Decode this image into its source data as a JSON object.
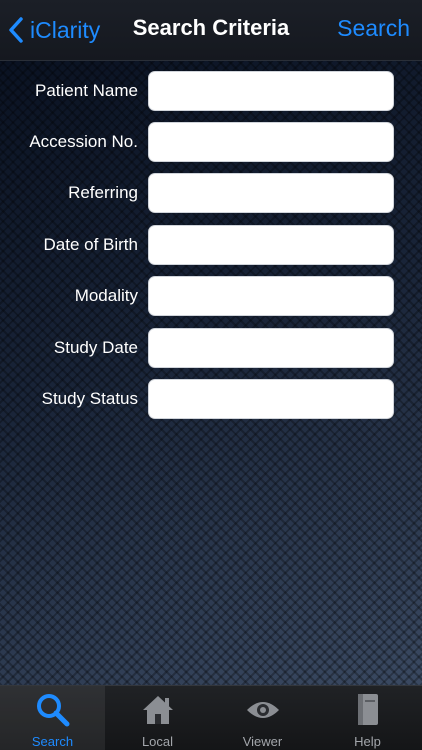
{
  "navbar": {
    "back_label": "iClarity",
    "title": "Search Criteria",
    "action_label": "Search"
  },
  "form": {
    "fields": [
      {
        "label": "Patient Name",
        "value": "",
        "placeholder": ""
      },
      {
        "label": "Accession No.",
        "value": "",
        "placeholder": ""
      },
      {
        "label": "Referring",
        "value": "",
        "placeholder": ""
      },
      {
        "label": "Date of Birth",
        "value": "",
        "placeholder": ""
      },
      {
        "label": "Modality",
        "value": "",
        "placeholder": ""
      },
      {
        "label": "Study Date",
        "value": "",
        "placeholder": ""
      },
      {
        "label": "Study Status",
        "value": "",
        "placeholder": ""
      }
    ]
  },
  "tabbar": {
    "tabs": [
      {
        "label": "Search",
        "icon": "search-icon",
        "active": true
      },
      {
        "label": "Local",
        "icon": "home-icon",
        "active": false
      },
      {
        "label": "Viewer",
        "icon": "eye-icon",
        "active": false
      },
      {
        "label": "Help",
        "icon": "book-icon",
        "active": false
      }
    ]
  },
  "colors": {
    "accent": "#1e8bff",
    "navbar_bg": "#1b1f27",
    "tab_inactive": "#a3a6ab",
    "field_bg": "#ffffff"
  }
}
